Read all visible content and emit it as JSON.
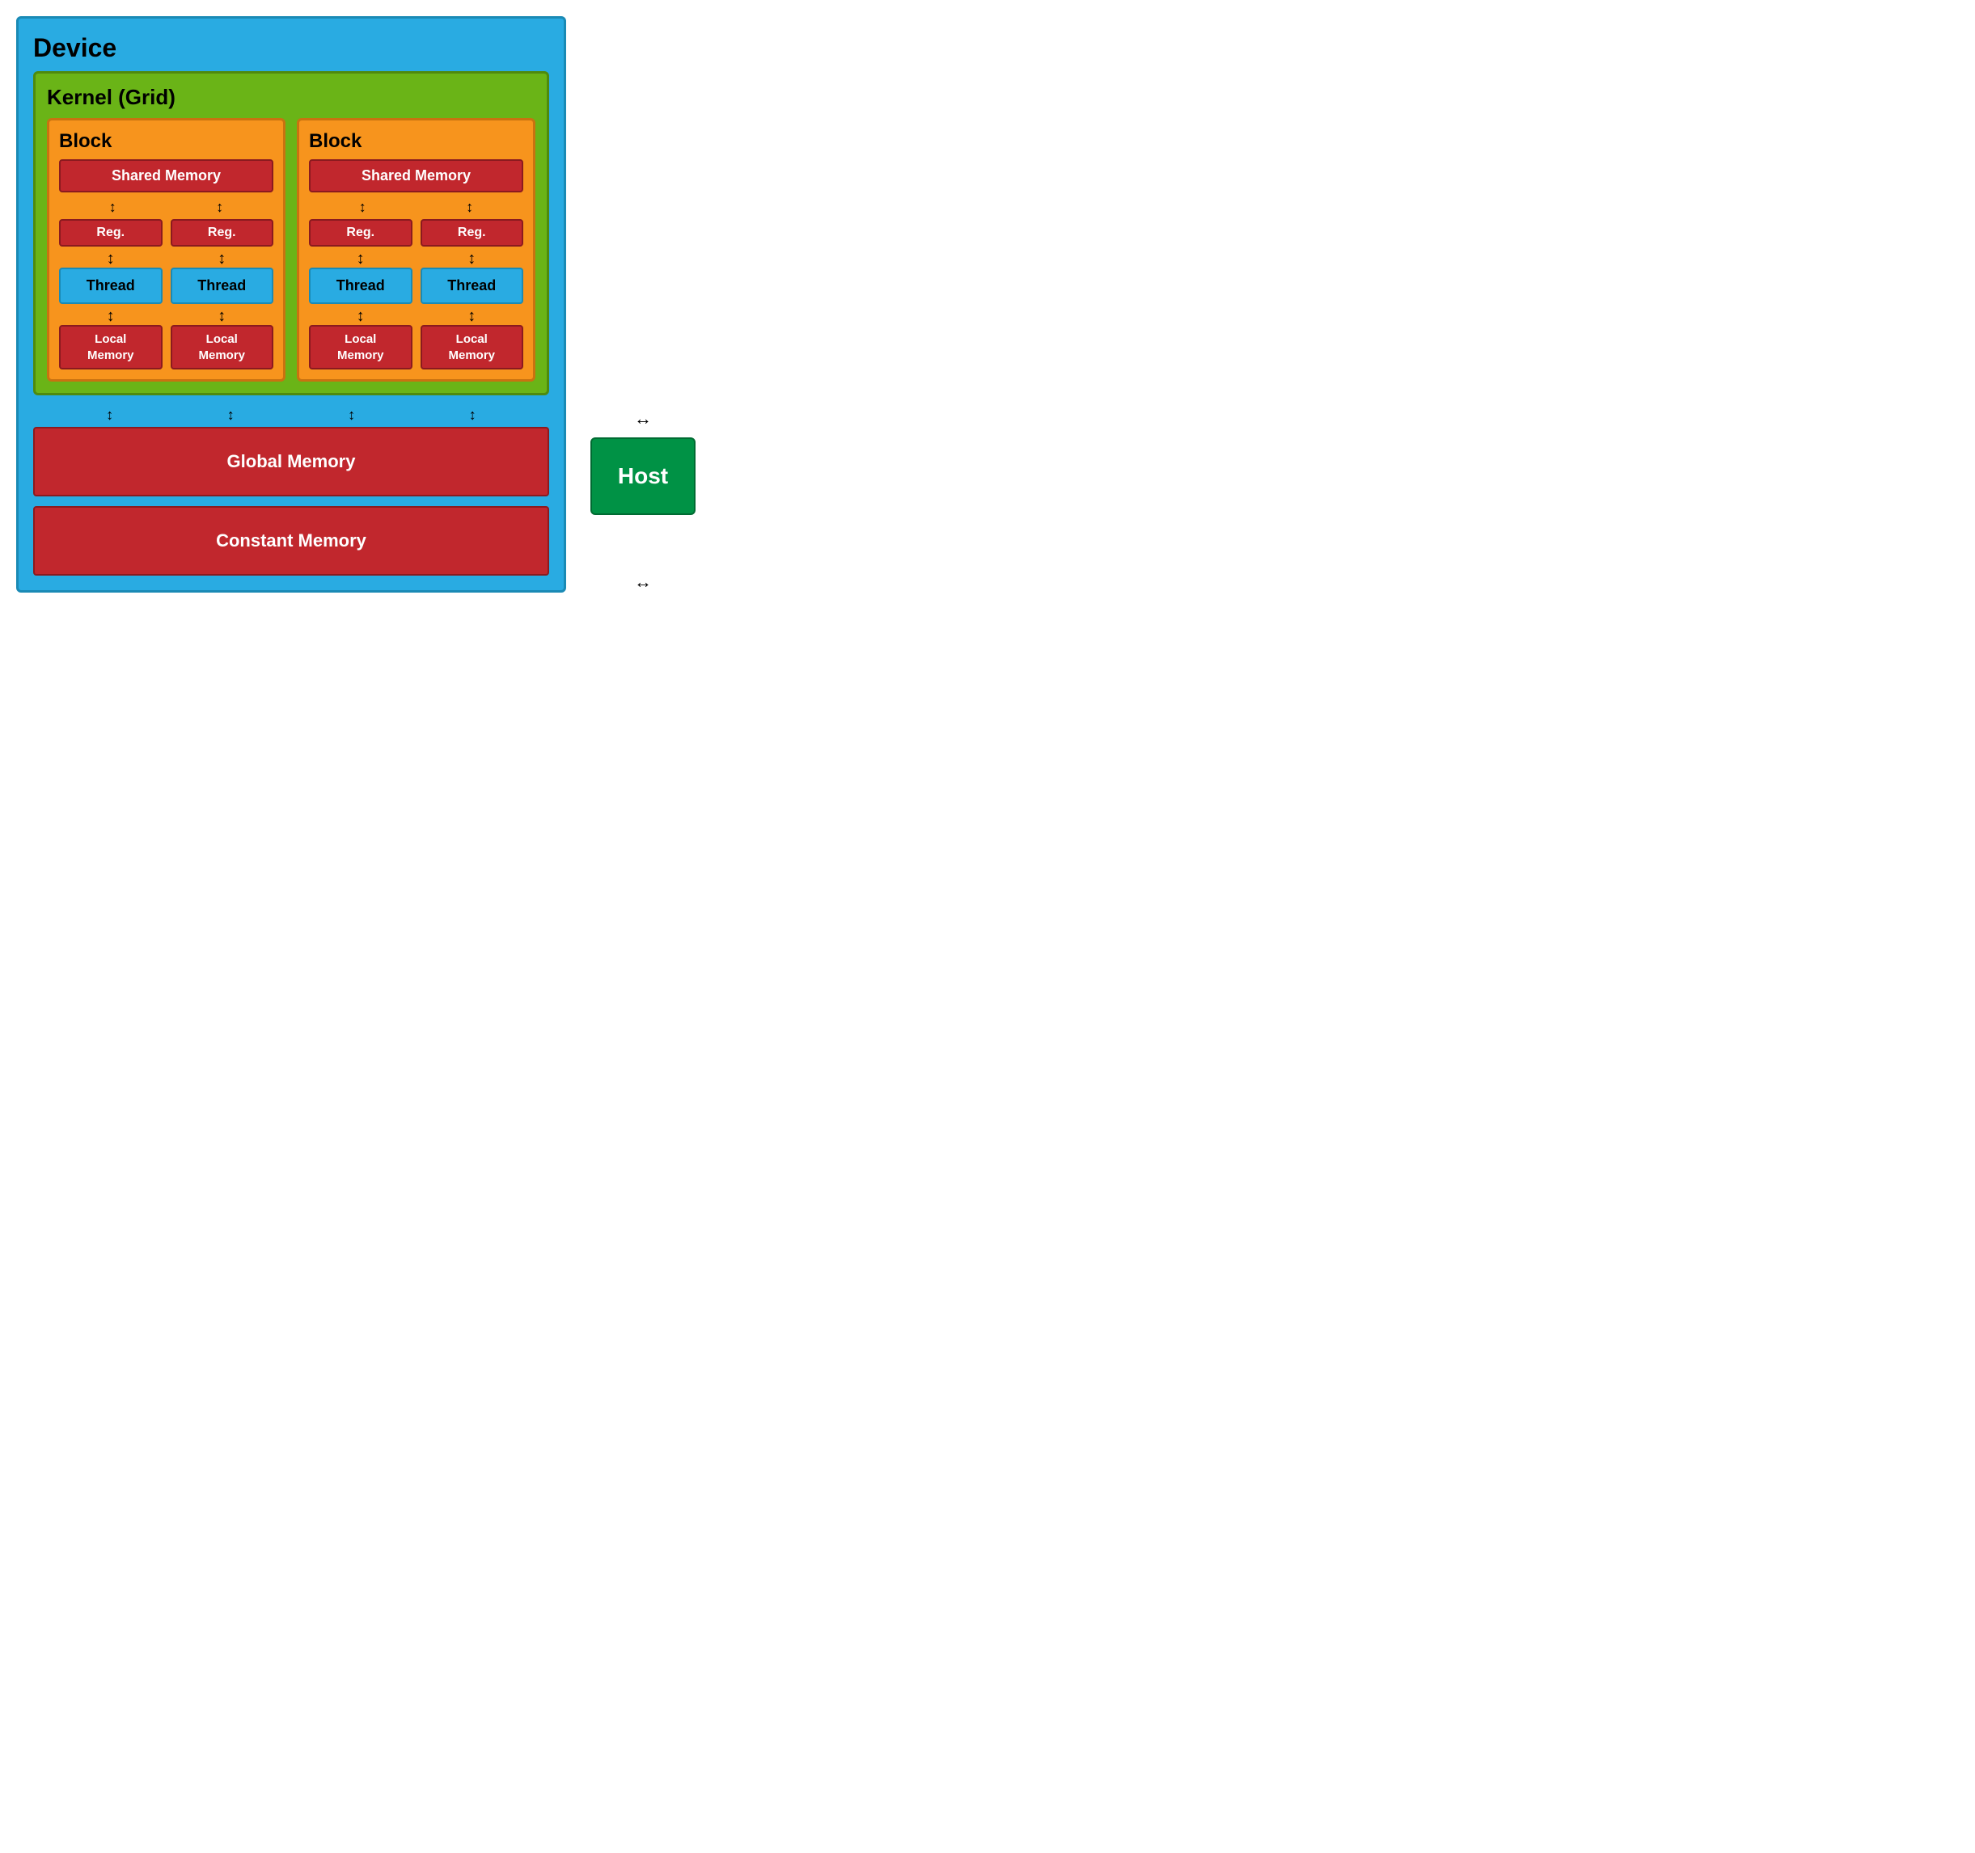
{
  "device": {
    "label": "Device"
  },
  "kernel": {
    "label": "Kernel (Grid)"
  },
  "blocks": [
    {
      "label": "Block",
      "shared_memory": "Shared Memory",
      "threads": [
        {
          "reg": "Reg.",
          "thread": "Thread",
          "local_memory": "Local\nMemory"
        },
        {
          "reg": "Reg.",
          "thread": "Thread",
          "local_memory": "Local\nMemory"
        }
      ]
    },
    {
      "label": "Block",
      "shared_memory": "Shared Memory",
      "threads": [
        {
          "reg": "Reg.",
          "thread": "Thread",
          "local_memory": "Local\nMemory"
        },
        {
          "reg": "Reg.",
          "thread": "Thread",
          "local_memory": "Local\nMemory"
        }
      ]
    }
  ],
  "global_memory": "Global Memory",
  "constant_memory": "Constant Memory",
  "host": "Host",
  "arrows": {
    "double": "↕",
    "up": "↑",
    "down": "↓",
    "left_right": "↔"
  }
}
